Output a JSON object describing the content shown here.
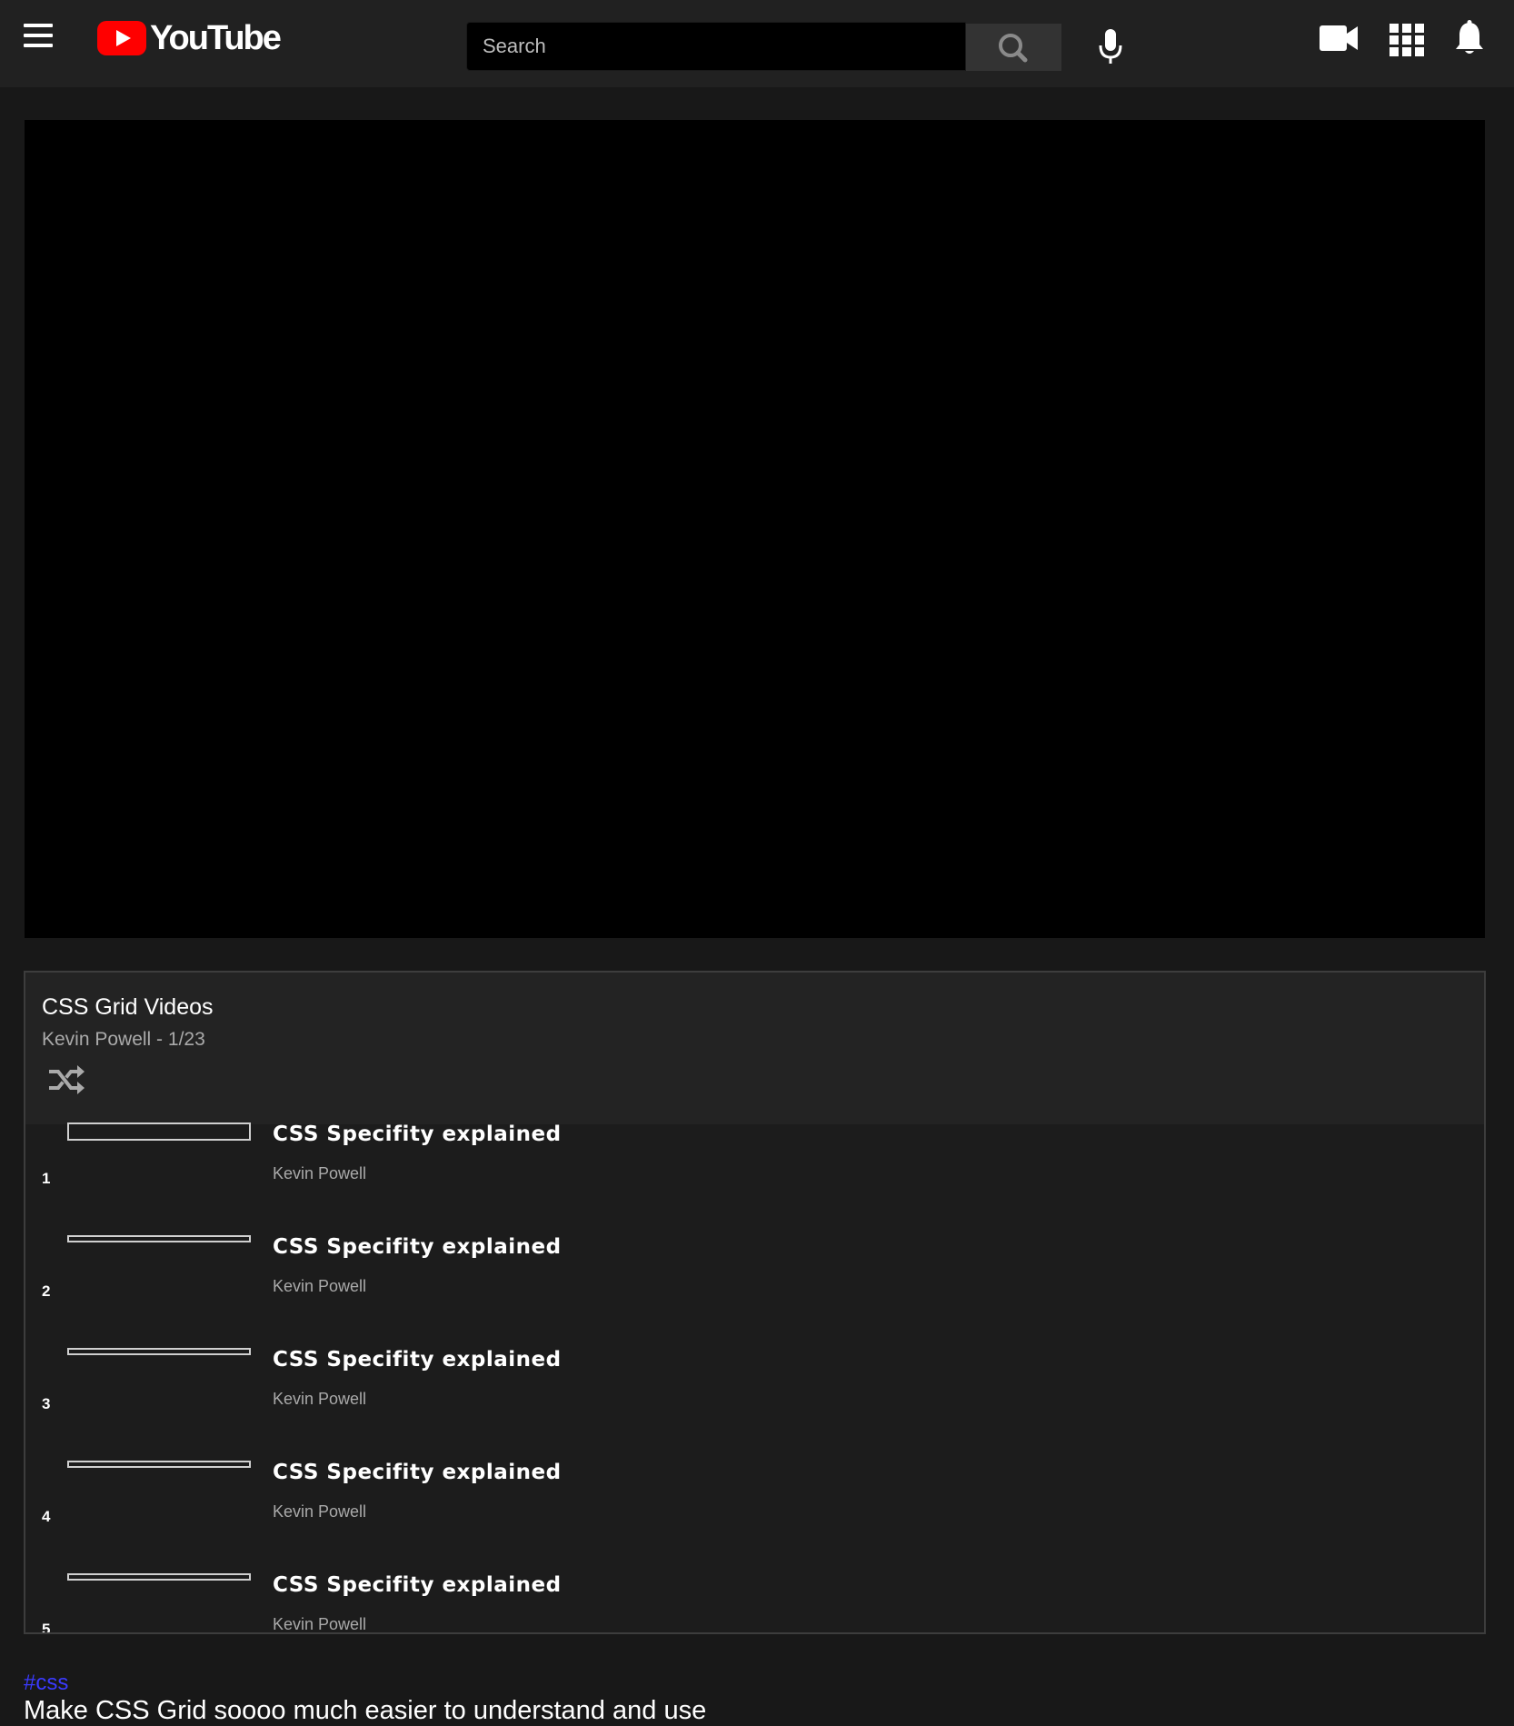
{
  "header": {
    "logo_text": "YouTube",
    "search_placeholder": "Search",
    "icons": [
      "menu-icon",
      "youtube-logo-icon",
      "search-icon",
      "mic-icon",
      "video-camera-icon",
      "apps-grid-icon",
      "bell-icon"
    ]
  },
  "playlist": {
    "title": "CSS Grid Videos",
    "subtitle": "Kevin Powell - 1/23",
    "items": [
      {
        "num": "1",
        "title": "CSS Specifity explained",
        "channel": "Kevin Powell"
      },
      {
        "num": "2",
        "title": "CSS Specifity explained",
        "channel": "Kevin Powell"
      },
      {
        "num": "3",
        "title": "CSS Specifity explained",
        "channel": "Kevin Powell"
      },
      {
        "num": "4",
        "title": "CSS Specifity explained",
        "channel": "Kevin Powell"
      },
      {
        "num": "5",
        "title": "CSS Specifity explained",
        "channel": "Kevin Powell"
      }
    ]
  },
  "video": {
    "hashtag": "#css",
    "title": "Make CSS Grid soooo much easier to understand and use"
  },
  "colors": {
    "background": "#181818",
    "topbar": "#212121",
    "brand_red": "#ff0000",
    "hashtag": "#3a3aff",
    "muted_text": "#aaaaaa"
  }
}
